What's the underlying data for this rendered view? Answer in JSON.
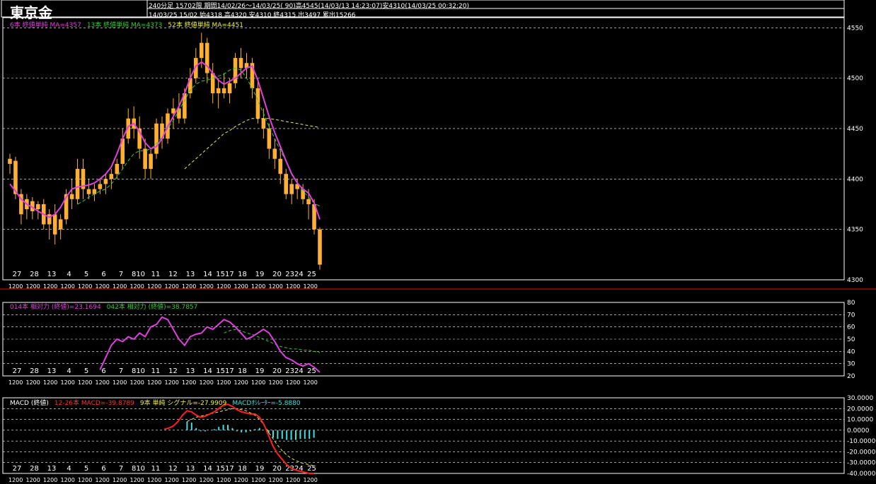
{
  "header": {
    "title": "東京金",
    "line1": "240分足 15702限 期間14/02/26～14/03/25( 90)高4545(14/03/13 14:23:07)安4310(14/03/25 00:32:20)",
    "line2": "14/03/25 15/02 始4318 高4320 安4310 終4315 出3497 累出15266"
  },
  "panels": {
    "price_legend": [
      {
        "text": "6本 終値単純 MA=4357",
        "color": "#e040e0"
      },
      {
        "text": "13本 終値単純 MA=4373",
        "color": "#30d030"
      },
      {
        "text": "52本 終値単純 MA=4451",
        "color": "#f0f040"
      }
    ],
    "rsi_legend": [
      {
        "text": "014本 相対力 (終値)=23.1694",
        "color": "#e040e0"
      },
      {
        "text": "042本 相対力 (終値)=38.7857",
        "color": "#30d030"
      }
    ],
    "macd_legend": [
      {
        "text": "MACD (終値)",
        "color": "#ffffff"
      },
      {
        "text": "12-26本 MACD=-39.8789",
        "color": "#ff3030"
      },
      {
        "text": "9本 単純 シグナル=-27.9909",
        "color": "#f0f040"
      },
      {
        "text": "MACDｵｼﾚｰﾀｰ=-5.8880",
        "color": "#40e0e0"
      }
    ]
  },
  "date_labels": [
    "27",
    "28",
    "13",
    "4",
    "5",
    "6",
    "7",
    "810",
    "11",
    "12",
    "13",
    "14",
    "1517",
    "18",
    "19",
    "20",
    "2324",
    "25"
  ],
  "colors": {
    "candle": "#ffb030",
    "ma6": "#e040e0",
    "ma13": "#30d030",
    "ma52": "#f0f040",
    "rsi14": "#e040e0",
    "rsi42": "#30d030",
    "macd": "#ff2020",
    "signal": "#f0f040",
    "hist": "#40e0e0",
    "grid": "#ffffff",
    "separator": "#ff0000"
  },
  "chart_data": [
    {
      "type": "candlestick",
      "title": "東京金",
      "ylim": [
        4300,
        4560
      ],
      "yticks": [
        4300,
        4350,
        4400,
        4450,
        4500,
        4550
      ],
      "ohlc": [
        [
          4415,
          4425,
          4405,
          4420
        ],
        [
          4418,
          4422,
          4380,
          4385
        ],
        [
          4385,
          4390,
          4355,
          4365
        ],
        [
          4370,
          4385,
          4360,
          4380
        ],
        [
          4378,
          4382,
          4360,
          4368
        ],
        [
          4370,
          4378,
          4360,
          4375
        ],
        [
          4375,
          4380,
          4350,
          4355
        ],
        [
          4355,
          4370,
          4340,
          4365
        ],
        [
          4365,
          4375,
          4335,
          4345
        ],
        [
          4350,
          4365,
          4340,
          4360
        ],
        [
          4360,
          4390,
          4355,
          4385
        ],
        [
          4385,
          4400,
          4370,
          4380
        ],
        [
          4380,
          4420,
          4375,
          4410
        ],
        [
          4410,
          4420,
          4380,
          4390
        ],
        [
          4390,
          4400,
          4380,
          4385
        ],
        [
          4385,
          4395,
          4378,
          4390
        ],
        [
          4390,
          4400,
          4385,
          4395
        ],
        [
          4395,
          4405,
          4385,
          4400
        ],
        [
          4400,
          4410,
          4390,
          4405
        ],
        [
          4405,
          4420,
          4400,
          4415
        ],
        [
          4415,
          4450,
          4410,
          4440
        ],
        [
          4440,
          4470,
          4435,
          4460
        ],
        [
          4460,
          4472,
          4440,
          4450
        ],
        [
          4450,
          4462,
          4420,
          4430
        ],
        [
          4430,
          4440,
          4400,
          4410
        ],
        [
          4410,
          4430,
          4400,
          4425
        ],
        [
          4425,
          4460,
          4420,
          4455
        ],
        [
          4455,
          4462,
          4430,
          4440
        ],
        [
          4440,
          4470,
          4435,
          4465
        ],
        [
          4465,
          4480,
          4450,
          4470
        ],
        [
          4470,
          4485,
          4455,
          4460
        ],
        [
          4460,
          4490,
          4455,
          4485
        ],
        [
          4485,
          4510,
          4480,
          4500
        ],
        [
          4500,
          4530,
          4495,
          4520
        ],
        [
          4520,
          4545,
          4510,
          4535
        ],
        [
          4535,
          4540,
          4495,
          4505
        ],
        [
          4505,
          4515,
          4475,
          4485
        ],
        [
          4485,
          4500,
          4470,
          4490
        ],
        [
          4490,
          4505,
          4480,
          4485
        ],
        [
          4485,
          4500,
          4475,
          4495
        ],
        [
          4495,
          4525,
          4490,
          4520
        ],
        [
          4520,
          4530,
          4500,
          4510
        ],
        [
          4510,
          4525,
          4500,
          4515
        ],
        [
          4515,
          4520,
          4480,
          4490
        ],
        [
          4490,
          4500,
          4455,
          4460
        ],
        [
          4460,
          4470,
          4440,
          4450
        ],
        [
          4450,
          4455,
          4420,
          4430
        ],
        [
          4430,
          4440,
          4410,
          4420
        ],
        [
          4420,
          4430,
          4395,
          4405
        ],
        [
          4405,
          4410,
          4380,
          4385
        ],
        [
          4385,
          4400,
          4375,
          4395
        ],
        [
          4395,
          4400,
          4380,
          4390
        ],
        [
          4390,
          4395,
          4375,
          4380
        ],
        [
          4380,
          4390,
          4360,
          4375
        ],
        [
          4375,
          4380,
          4345,
          4350
        ],
        [
          4350,
          4352,
          4310,
          4315
        ]
      ],
      "ma6": [
        4395,
        4388,
        4380,
        4375,
        4372,
        4368,
        4365,
        4362,
        4365,
        4372,
        4382,
        4390,
        4392,
        4393,
        4394,
        4396,
        4400,
        4405,
        4412,
        4425,
        4440,
        4452,
        4455,
        4447,
        4436,
        4430,
        4432,
        4440,
        4452,
        4462,
        4472,
        4485,
        4500,
        4512,
        4516,
        4512,
        4505,
        4498,
        4494,
        4497,
        4500,
        4505,
        4510,
        4512,
        4498,
        4480,
        4462,
        4446,
        4432,
        4418,
        4405,
        4396,
        4390,
        4386,
        4376,
        4360
      ],
      "ma13": [
        null,
        null,
        null,
        null,
        null,
        null,
        null,
        null,
        null,
        null,
        null,
        null,
        4375,
        4378,
        4382,
        4385,
        4388,
        4390,
        4395,
        4402,
        4410,
        4418,
        4425,
        4428,
        4428,
        4430,
        4435,
        4442,
        4450,
        4458,
        4468,
        4478,
        4488,
        4494,
        4497,
        4498,
        4500,
        4502,
        4504,
        4508,
        4510,
        4508,
        4500,
        4490,
        4478,
        4465,
        4452,
        4440,
        4428,
        4418,
        4406,
        4396,
        4388,
        4382,
        4376,
        4373
      ],
      "ma52": [
        null,
        null,
        null,
        null,
        null,
        null,
        null,
        null,
        null,
        null,
        null,
        null,
        null,
        null,
        null,
        null,
        null,
        null,
        null,
        null,
        null,
        null,
        null,
        null,
        null,
        null,
        null,
        null,
        null,
        null,
        null,
        4410,
        4415,
        4420,
        4425,
        4430,
        4435,
        4440,
        4445,
        4448,
        4452,
        4455,
        4458,
        4460,
        4460,
        4460,
        4460,
        4459,
        4458,
        4457,
        4456,
        4455,
        4454,
        4453,
        4452,
        4451
      ]
    },
    {
      "type": "line",
      "title": "相対力",
      "ylim": [
        20,
        80
      ],
      "yticks": [
        20,
        30,
        40,
        50,
        60,
        70,
        80
      ],
      "series": [
        {
          "name": "014本 相対力 (終値)",
          "values": [
            null,
            null,
            null,
            null,
            null,
            null,
            null,
            null,
            null,
            null,
            null,
            null,
            null,
            null,
            null,
            null,
            25,
            35,
            45,
            50,
            48,
            52,
            50,
            55,
            52,
            60,
            62,
            68,
            66,
            58,
            50,
            45,
            52,
            54,
            55,
            60,
            58,
            62,
            66,
            64,
            60,
            55,
            50,
            52,
            55,
            58,
            55,
            48,
            40,
            35,
            33,
            30,
            28,
            30,
            27,
            23
          ]
        },
        {
          "name": "042本 相対力 (終値)",
          "values": [
            null,
            null,
            null,
            null,
            null,
            null,
            null,
            null,
            null,
            null,
            null,
            null,
            null,
            null,
            null,
            null,
            null,
            null,
            null,
            null,
            null,
            null,
            null,
            null,
            null,
            null,
            null,
            null,
            null,
            null,
            null,
            null,
            null,
            null,
            null,
            null,
            null,
            null,
            55,
            57,
            58,
            57,
            55,
            54,
            52,
            50,
            48,
            46,
            44,
            43,
            42,
            42,
            41,
            41,
            40,
            39
          ]
        }
      ]
    },
    {
      "type": "line",
      "title": "MACD (終値)",
      "ylim": [
        -40,
        30
      ],
      "yticks": [
        -40,
        -30,
        -20,
        -10,
        0,
        10,
        20,
        30
      ],
      "series": [
        {
          "name": "12-26本 MACD",
          "values": [
            null,
            null,
            null,
            null,
            null,
            null,
            null,
            null,
            null,
            null,
            null,
            null,
            null,
            null,
            null,
            null,
            1,
            2,
            4,
            8,
            14,
            18,
            17,
            14,
            12,
            13,
            15,
            17,
            20,
            23,
            24,
            22,
            19,
            17,
            16,
            15,
            15,
            12,
            5,
            -5,
            -15,
            -22,
            -27,
            -32,
            -35,
            -37,
            -38,
            -39,
            -40,
            -40
          ]
        },
        {
          "name": "9本 単純 シグナル",
          "values": [
            null,
            null,
            null,
            null,
            null,
            null,
            null,
            null,
            null,
            null,
            null,
            null,
            null,
            null,
            null,
            null,
            null,
            null,
            null,
            null,
            null,
            8,
            10,
            12,
            13,
            14,
            15,
            16,
            17,
            18,
            19,
            20,
            20,
            19,
            18,
            16,
            14,
            10,
            5,
            -2,
            -8,
            -14,
            -19,
            -23,
            -26,
            -28,
            -30,
            -31,
            -32,
            -33
          ]
        },
        {
          "name": "MACDｵｼﾚｰﾀｰ",
          "values": [
            null,
            null,
            null,
            null,
            null,
            null,
            null,
            null,
            null,
            null,
            null,
            null,
            null,
            null,
            null,
            null,
            null,
            null,
            null,
            null,
            null,
            8,
            7,
            2,
            -1,
            -1,
            0,
            1,
            3,
            5,
            5,
            2,
            -1,
            -2,
            -2,
            -1,
            1,
            2,
            0,
            -3,
            -7,
            -8,
            -8,
            -9,
            -9,
            -9,
            -8,
            -8,
            -8,
            -7
          ]
        }
      ]
    }
  ]
}
